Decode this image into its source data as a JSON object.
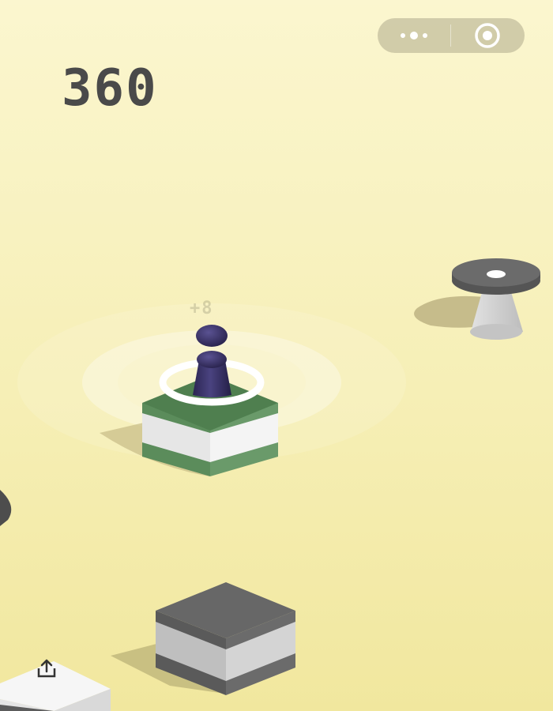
{
  "hud": {
    "score": "360",
    "bonus_popup": "+8"
  },
  "capsule": {
    "more_icon": "more-dots-icon",
    "close_icon": "target-circle-icon"
  },
  "colors": {
    "background_top": "#fbf6cf",
    "background_bottom": "#f1e79e",
    "score_text": "#4a4a4a",
    "block_green": "#5e8e5e",
    "block_gray": "#666666",
    "block_white": "#eeeeee",
    "player": "#3a3364",
    "glow_ring": "#ffffff"
  },
  "share_icon": "share-upload-icon"
}
